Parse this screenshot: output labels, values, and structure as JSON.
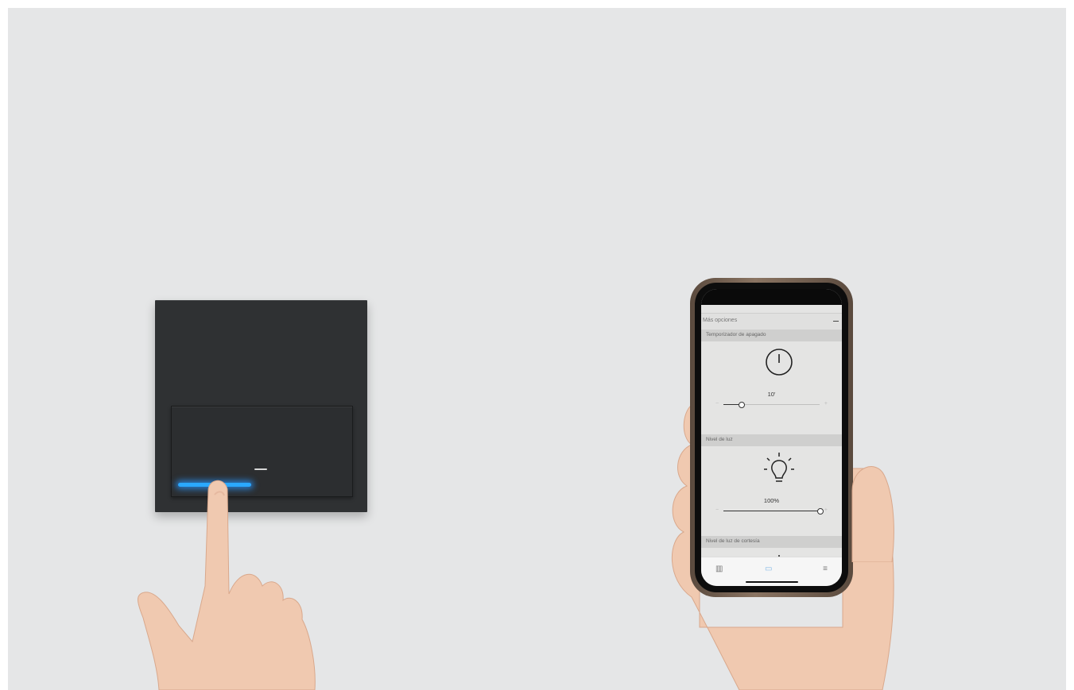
{
  "app": {
    "more_options_label": "Más opciones",
    "sections": [
      {
        "title": "Temporizador de apagado",
        "icon": "power-timer-icon",
        "value_label": "10'",
        "level": 0.18
      },
      {
        "title": "Nivel de luz",
        "icon": "light-bulb-icon",
        "value_label": "100%",
        "level": 1.0
      },
      {
        "title": "Nivel de luz de cortesía",
        "icon": "light-bulb-icon"
      }
    ],
    "tabs": [
      {
        "icon": "devices-icon",
        "active": false
      },
      {
        "icon": "room-icon",
        "active": true
      },
      {
        "icon": "menu-icon",
        "active": false
      }
    ],
    "accent_color": "#2aa8ff"
  },
  "scene": {
    "switch_led_color": "#2aa8ff",
    "background_color": "#e5e6e7"
  }
}
